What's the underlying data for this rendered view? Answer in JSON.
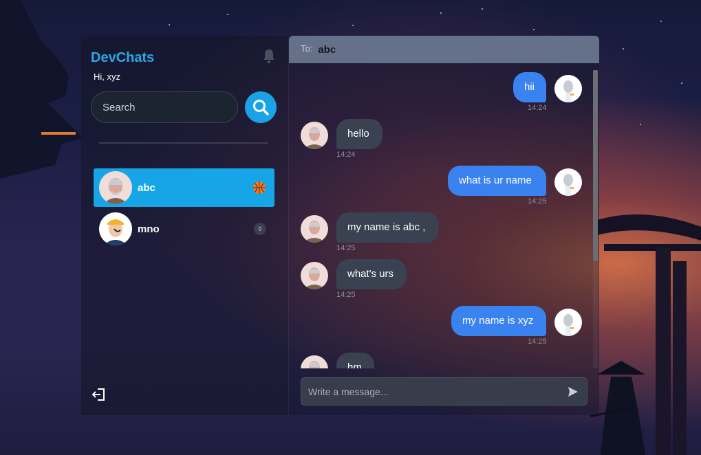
{
  "app": {
    "brand": "DevChats",
    "greeting": "Hi, xyz"
  },
  "search": {
    "placeholder": "Search"
  },
  "contacts": [
    {
      "name": "abc",
      "active": true,
      "badge": "basketball-icon"
    },
    {
      "name": "mno",
      "active": false,
      "badge": "0"
    }
  ],
  "chat": {
    "to_label": "To:",
    "recipient": "abc",
    "messages": [
      {
        "text": "hii",
        "time": "14:24",
        "direction": "out"
      },
      {
        "text": "hello",
        "time": "14:24",
        "direction": "in"
      },
      {
        "text": "what is ur name",
        "time": "14:25",
        "direction": "out"
      },
      {
        "text": "my name is abc ,",
        "time": "14:25",
        "direction": "in"
      },
      {
        "text": "what's urs",
        "time": "14:25",
        "direction": "in"
      },
      {
        "text": "my name is xyz",
        "time": "14:25",
        "direction": "out"
      },
      {
        "text": "hm",
        "time": "",
        "direction": "in"
      }
    ],
    "composer_placeholder": "Write a message..."
  },
  "colors": {
    "accent": "#16a6e8",
    "outgoing": "#3a82f0",
    "incoming": "#3a4150",
    "header": "#647189"
  }
}
